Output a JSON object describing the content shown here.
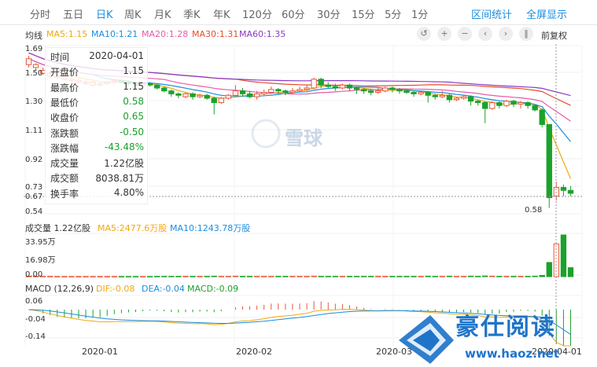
{
  "tabs": [
    "分时",
    "五日",
    "日K",
    "周K",
    "月K",
    "季K",
    "年K",
    "120分",
    "60分",
    "30分",
    "15分",
    "5分",
    "1分"
  ],
  "active_tab": "日K",
  "tab_right": [
    "区间统计",
    "全屏显示"
  ],
  "ma_bar": {
    "label": "均线",
    "ma5": "MA5:1.15",
    "ma10": "MA10:1.21",
    "ma20": "MA20:1.28",
    "ma30": "MA30:1.31",
    "ma60": "MA60:1.35"
  },
  "controls": {
    "adjust": "前复权"
  },
  "tooltip": [
    {
      "k": "时间",
      "v": "2020-04-01",
      "color": "#333333"
    },
    {
      "k": "开盘价",
      "v": "1.15",
      "color": "#333333"
    },
    {
      "k": "最高价",
      "v": "1.15",
      "color": "#333333"
    },
    {
      "k": "最低价",
      "v": "0.58",
      "color": "#1aa22b"
    },
    {
      "k": "收盘价",
      "v": "0.65",
      "color": "#1aa22b"
    },
    {
      "k": "涨跌额",
      "v": "-0.50",
      "color": "#1aa22b"
    },
    {
      "k": "涨跌幅",
      "v": "-43.48%",
      "color": "#1aa22b"
    },
    {
      "k": "成交量",
      "v": "1.22亿股",
      "color": "#333333"
    },
    {
      "k": "成交额",
      "v": "8038.81万",
      "color": "#333333"
    },
    {
      "k": "换手率",
      "v": "4.80%",
      "color": "#333333"
    }
  ],
  "price_axis": [
    "1.69",
    "1.50",
    "1.30",
    "1.11",
    "0.92",
    "0.73",
    "0.67",
    "0.54"
  ],
  "low_marker": "0.58",
  "volume_bar": {
    "label": "成交量 1.22亿股",
    "ma5": "MA5:2477.6万股",
    "ma10": "MA10:1243.78万股"
  },
  "volume_axis": [
    "33.95万",
    "16.98万",
    "0.00"
  ],
  "macd_bar": {
    "label": "MACD (12,26,9)",
    "dif": "DIF:-0.08",
    "dea": "DEA:-0.04",
    "macd": "MACD:-0.09"
  },
  "macd_axis": [
    "0.06",
    "-0.04",
    "-0.14"
  ],
  "x_axis": [
    "2020-01",
    "2020-02",
    "2020-03",
    "2020-04-01"
  ],
  "watermark": {
    "center": "雪球",
    "brand": "豪仕阅读",
    "url": "www.haoz.net"
  },
  "colors": {
    "up": "#e8573a",
    "down": "#1aa22b",
    "ma5": "#f0a80f",
    "ma10": "#1a8ddf",
    "ma20": "#e85ba8",
    "ma30": "#e64d2e",
    "ma60": "#8a3ac4",
    "accent": "#1a8ddf"
  },
  "chart_data": {
    "type": "candlestick",
    "price_range": [
      0.54,
      1.69
    ],
    "x_labels": [
      "2020-01",
      "2020-02",
      "2020-03",
      "2020-04-01"
    ],
    "candles": [
      [
        1.56,
        1.6,
        1.62,
        1.54
      ],
      [
        1.54,
        1.56,
        1.57,
        1.52
      ],
      [
        1.5,
        1.52,
        1.54,
        1.49
      ],
      [
        1.48,
        1.5,
        1.51,
        1.47
      ],
      [
        1.47,
        1.48,
        1.5,
        1.46
      ],
      [
        1.46,
        1.48,
        1.49,
        1.45
      ],
      [
        1.45,
        1.46,
        1.48,
        1.44
      ],
      [
        1.44,
        1.45,
        1.47,
        1.43
      ],
      [
        1.43,
        1.44,
        1.46,
        1.42
      ],
      [
        1.42,
        1.44,
        1.45,
        1.41
      ],
      [
        1.42,
        1.43,
        1.44,
        1.41
      ],
      [
        1.43,
        1.44,
        1.45,
        1.42
      ],
      [
        1.44,
        1.45,
        1.46,
        1.43
      ],
      [
        1.45,
        1.44,
        1.46,
        1.43
      ],
      [
        1.44,
        1.43,
        1.45,
        1.42
      ],
      [
        1.43,
        1.42,
        1.44,
        1.41
      ],
      [
        1.42,
        1.43,
        1.44,
        1.41
      ],
      [
        1.43,
        1.42,
        1.44,
        1.41
      ],
      [
        1.42,
        1.4,
        1.43,
        1.39
      ],
      [
        1.4,
        1.38,
        1.41,
        1.37
      ],
      [
        1.38,
        1.36,
        1.39,
        1.34
      ],
      [
        1.36,
        1.35,
        1.37,
        1.33
      ],
      [
        1.34,
        1.36,
        1.37,
        1.33
      ],
      [
        1.36,
        1.34,
        1.37,
        1.32
      ],
      [
        1.34,
        1.35,
        1.36,
        1.33
      ],
      [
        1.35,
        1.33,
        1.36,
        1.32
      ],
      [
        1.33,
        1.3,
        1.34,
        1.22
      ],
      [
        1.3,
        1.33,
        1.34,
        1.29
      ],
      [
        1.33,
        1.35,
        1.36,
        1.32
      ],
      [
        1.35,
        1.38,
        1.42,
        1.34
      ],
      [
        1.38,
        1.36,
        1.4,
        1.34
      ],
      [
        1.36,
        1.34,
        1.38,
        1.33
      ],
      [
        1.34,
        1.36,
        1.38,
        1.32
      ],
      [
        1.36,
        1.37,
        1.39,
        1.35
      ],
      [
        1.37,
        1.39,
        1.41,
        1.36
      ],
      [
        1.39,
        1.38,
        1.4,
        1.36
      ],
      [
        1.38,
        1.37,
        1.39,
        1.35
      ],
      [
        1.37,
        1.38,
        1.4,
        1.36
      ],
      [
        1.38,
        1.39,
        1.41,
        1.37
      ],
      [
        1.39,
        1.4,
        1.42,
        1.38
      ],
      [
        1.4,
        1.46,
        1.47,
        1.39
      ],
      [
        1.46,
        1.42,
        1.47,
        1.4
      ],
      [
        1.42,
        1.41,
        1.44,
        1.4
      ],
      [
        1.41,
        1.4,
        1.43,
        1.38
      ],
      [
        1.4,
        1.42,
        1.43,
        1.39
      ],
      [
        1.42,
        1.4,
        1.43,
        1.38
      ],
      [
        1.4,
        1.39,
        1.41,
        1.36
      ],
      [
        1.39,
        1.38,
        1.4,
        1.36
      ],
      [
        1.38,
        1.37,
        1.39,
        1.35
      ],
      [
        1.37,
        1.38,
        1.4,
        1.36
      ],
      [
        1.38,
        1.4,
        1.41,
        1.37
      ],
      [
        1.4,
        1.39,
        1.41,
        1.37
      ],
      [
        1.39,
        1.38,
        1.4,
        1.36
      ],
      [
        1.38,
        1.37,
        1.39,
        1.36
      ],
      [
        1.37,
        1.36,
        1.38,
        1.34
      ],
      [
        1.36,
        1.37,
        1.38,
        1.35
      ],
      [
        1.37,
        1.35,
        1.38,
        1.3
      ],
      [
        1.35,
        1.34,
        1.36,
        1.32
      ],
      [
        1.34,
        1.35,
        1.38,
        1.33
      ],
      [
        1.35,
        1.32,
        1.36,
        1.3
      ],
      [
        1.32,
        1.33,
        1.34,
        1.31
      ],
      [
        1.33,
        1.34,
        1.35,
        1.32
      ],
      [
        1.34,
        1.31,
        1.35,
        1.28
      ],
      [
        1.31,
        1.3,
        1.32,
        1.28
      ],
      [
        1.3,
        1.26,
        1.31,
        1.16
      ],
      [
        1.26,
        1.3,
        1.31,
        1.25
      ],
      [
        1.3,
        1.28,
        1.31,
        1.26
      ],
      [
        1.28,
        1.31,
        1.32,
        1.27
      ],
      [
        1.31,
        1.29,
        1.32,
        1.27
      ],
      [
        1.29,
        1.3,
        1.31,
        1.26
      ],
      [
        1.3,
        1.28,
        1.31,
        1.26
      ],
      [
        1.28,
        1.25,
        1.29,
        1.24
      ],
      [
        1.25,
        1.15,
        1.26,
        1.13
      ],
      [
        1.15,
        0.65,
        1.15,
        0.58
      ],
      [
        0.66,
        0.72,
        0.76,
        0.63
      ],
      [
        0.72,
        0.7,
        0.74,
        0.66
      ],
      [
        0.7,
        0.68,
        0.73,
        0.66
      ]
    ],
    "volume": [
      2,
      2,
      2,
      2,
      1,
      1,
      1,
      1,
      1,
      1,
      1,
      1,
      1,
      1,
      1,
      1,
      1,
      1,
      2,
      2,
      2,
      2,
      2,
      2,
      2,
      2,
      3,
      2,
      2,
      3,
      2,
      2,
      2,
      2,
      2,
      2,
      2,
      2,
      2,
      2,
      3,
      2,
      2,
      2,
      2,
      2,
      2,
      2,
      2,
      2,
      2,
      2,
      2,
      2,
      2,
      2,
      3,
      2,
      2,
      3,
      2,
      2,
      3,
      2,
      4,
      3,
      2,
      2,
      2,
      2,
      2,
      3,
      8,
      95,
      220,
      280,
      60
    ],
    "volume_unit": "万股",
    "volume_range": [
      0,
      33.95
    ],
    "macd_range": [
      -0.14,
      0.06
    ]
  }
}
